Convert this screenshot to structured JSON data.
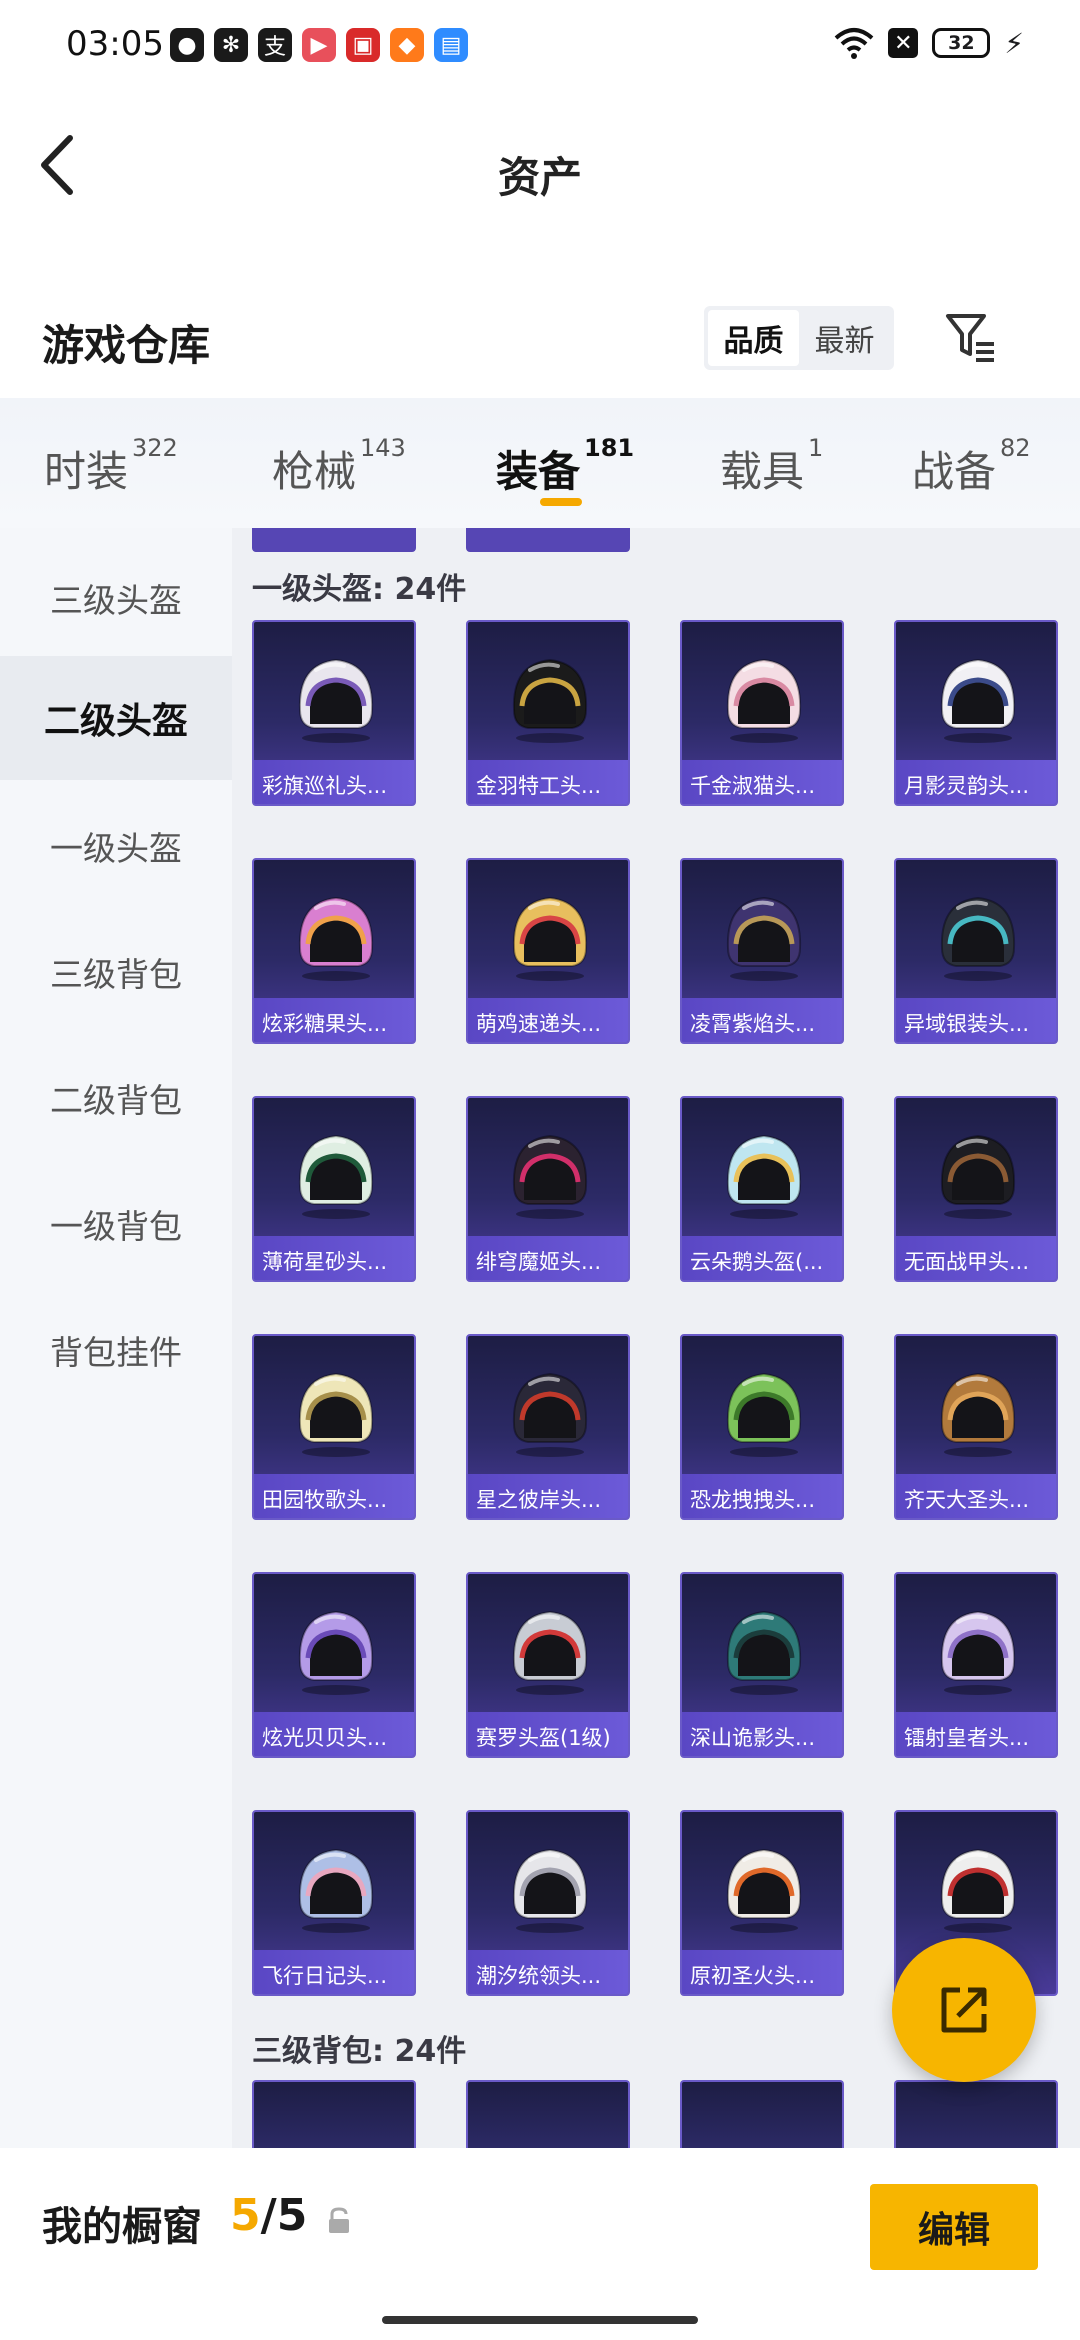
{
  "status_bar": {
    "time": "03:05",
    "battery": "32",
    "apps": [
      {
        "icon": "shield-app-icon",
        "color": "#1a1a1a",
        "glyph": "●"
      },
      {
        "icon": "wechat-icon",
        "color": "#1a1a1a",
        "glyph": "✻"
      },
      {
        "icon": "alipay-icon",
        "color": "#1a1a1a",
        "glyph": "支"
      },
      {
        "icon": "video-app-icon",
        "color": "#e8505b",
        "glyph": "▶"
      },
      {
        "icon": "red-app-icon",
        "color": "#d92a2a",
        "glyph": "▣"
      },
      {
        "icon": "orange-app-icon",
        "color": "#ff7a1a",
        "glyph": "◆"
      },
      {
        "icon": "blue-app-icon",
        "color": "#2f8cff",
        "glyph": "▤"
      }
    ]
  },
  "header": {
    "title": "资产"
  },
  "warehouse": {
    "title": "游戏仓库"
  },
  "sort": {
    "options": [
      "品质",
      "最新"
    ],
    "active": "品质"
  },
  "tabs": [
    {
      "label": "时装",
      "count": "322"
    },
    {
      "label": "枪械",
      "count": "143"
    },
    {
      "label": "装备",
      "count": "181",
      "active": true
    },
    {
      "label": "载具",
      "count": "1"
    },
    {
      "label": "战备",
      "count": "82"
    }
  ],
  "sidebar": {
    "items": [
      "三级头盔",
      "二级头盔",
      "一级头盔",
      "三级背包",
      "二级背包",
      "一级背包",
      "背包挂件"
    ],
    "active": "二级头盔"
  },
  "sections": [
    {
      "title": "一级头盔: 24件",
      "items": [
        {
          "label": "彩旗巡礼头...",
          "shell": "#e9e6ee",
          "accent": "#7a5bb8"
        },
        {
          "label": "金羽特工头...",
          "shell": "#1b1b1b",
          "accent": "#c9a441"
        },
        {
          "label": "千金淑猫头...",
          "shell": "#f4dde4",
          "accent": "#d98aa3"
        },
        {
          "label": "月影灵韵头...",
          "shell": "#f1f0f4",
          "accent": "#3b4b8a"
        },
        {
          "label": "炫彩糖果头...",
          "shell": "#d97fd0",
          "accent": "#f0a14b"
        },
        {
          "label": "萌鸡速递头...",
          "shell": "#e8bf5e",
          "accent": "#d84545"
        },
        {
          "label": "凌霄紫焰头...",
          "shell": "#3f3470",
          "accent": "#b89858"
        },
        {
          "label": "异域银装头...",
          "shell": "#2a2f3a",
          "accent": "#47b8c2"
        },
        {
          "label": "薄荷星砂头...",
          "shell": "#dfeee2",
          "accent": "#1f5a3a"
        },
        {
          "label": "绯穹魔姬头...",
          "shell": "#2b2230",
          "accent": "#d12f6a"
        },
        {
          "label": "云朵鹅头盔(...",
          "shell": "#bfe6f0",
          "accent": "#e8c15a"
        },
        {
          "label": "无面战甲头...",
          "shell": "#1d1d22",
          "accent": "#8a5a34"
        },
        {
          "label": "田园牧歌头...",
          "shell": "#eee6b8",
          "accent": "#a68f4a"
        },
        {
          "label": "星之彼岸头...",
          "shell": "#2a2838",
          "accent": "#c0392b"
        },
        {
          "label": "恐龙拽拽头...",
          "shell": "#7cc25a",
          "accent": "#3d7a2a"
        },
        {
          "label": "齐天大圣头...",
          "shell": "#b27a3c",
          "accent": "#e0a458"
        },
        {
          "label": "炫光贝贝头...",
          "shell": "#b49be8",
          "accent": "#6a4bb8"
        },
        {
          "label": "赛罗头盔(1级)",
          "shell": "#c8ccd4",
          "accent": "#d23a3a"
        },
        {
          "label": "深山诡影头...",
          "shell": "#2e7a78",
          "accent": "#1b3d3c"
        },
        {
          "label": "镭射皇者头...",
          "shell": "#d6c6ee",
          "accent": "#8f72c8"
        },
        {
          "label": "飞行日记头...",
          "shell": "#aebfe6",
          "accent": "#e8a8c0"
        },
        {
          "label": "潮汐统领头...",
          "shell": "#e6e6ea",
          "accent": "#a3a3b0"
        },
        {
          "label": "原初圣火头...",
          "shell": "#f0ece6",
          "accent": "#e0692a"
        },
        {
          "label": "",
          "shell": "#eeeeee",
          "accent": "#c03030"
        }
      ]
    },
    {
      "title": "三级背包: 24件"
    }
  ],
  "bottom_bar": {
    "label": "我的橱窗",
    "current": "5",
    "total": "/5",
    "edit_label": "编辑"
  },
  "colors": {
    "accent": "#f7b500",
    "card_label": "#5a47c4",
    "card_bg": "#2c2a66"
  }
}
